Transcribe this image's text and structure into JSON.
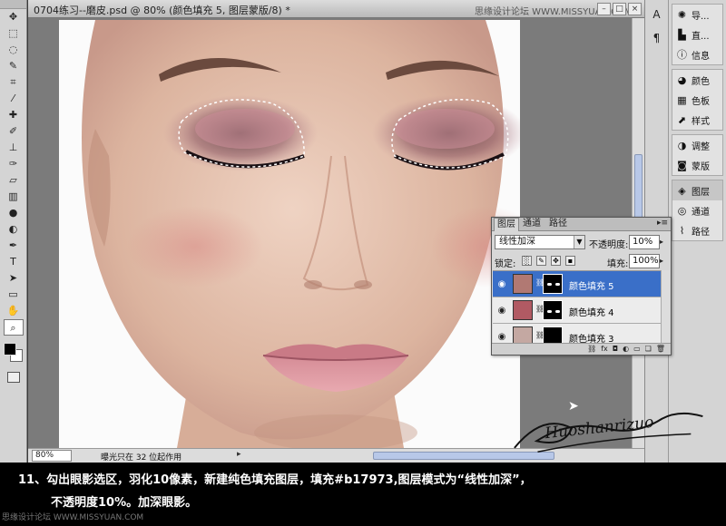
{
  "document": {
    "title": "0704练习--磨皮.psd @ 80% (颜色填充 5, 图层蒙版/8) *",
    "watermark_top": "思缘设计论坛 WWW.MISSYUAN.COM",
    "zoom": "80%",
    "status": "曝光只在 32 位起作用"
  },
  "toolbar": {
    "tools": [
      "move-tool",
      "marquee-tool",
      "lasso-tool",
      "quick-select-tool",
      "crop-tool",
      "eyedropper-tool",
      "healing-tool",
      "brush-tool",
      "clone-stamp-tool",
      "history-brush-tool",
      "eraser-tool",
      "gradient-tool",
      "blur-tool",
      "dodge-tool",
      "pen-tool",
      "type-tool",
      "path-select-tool",
      "shape-tool",
      "hand-tool",
      "zoom-tool"
    ],
    "foreground_color": "#000000",
    "background_color": "#ffffff"
  },
  "dock": {
    "strip_items": [
      "A",
      "¶"
    ],
    "groups": [
      [
        {
          "label": "导...",
          "icon": "navigator-icon"
        },
        {
          "label": "直...",
          "icon": "histogram-icon"
        },
        {
          "label": "信息",
          "icon": "info-icon"
        }
      ],
      [
        {
          "label": "颜色",
          "icon": "color-icon"
        },
        {
          "label": "色板",
          "icon": "swatches-icon"
        },
        {
          "label": "样式",
          "icon": "styles-icon"
        }
      ],
      [
        {
          "label": "调整",
          "icon": "adjustments-icon"
        },
        {
          "label": "蒙版",
          "icon": "masks-icon"
        }
      ],
      [
        {
          "label": "图层",
          "icon": "layers-icon",
          "selected": true
        },
        {
          "label": "通道",
          "icon": "channels-icon"
        },
        {
          "label": "路径",
          "icon": "paths-icon"
        }
      ]
    ]
  },
  "layers_panel": {
    "tabs": [
      "图层",
      "通道",
      "路径"
    ],
    "menu": "▸≡",
    "blend_mode": "线性加深",
    "opacity_label": "不透明度:",
    "opacity": "10%",
    "lock_label": "锁定:",
    "fill_label": "填充:",
    "fill": "100%",
    "layers": [
      {
        "name": "颜色填充 5",
        "fill_color": "#b17973",
        "selected": true
      },
      {
        "name": "颜色填充 4",
        "fill_color": "#b15a63",
        "selected": false
      },
      {
        "name": "颜色填充 3",
        "fill_color": "#c4a8a2",
        "selected": false
      }
    ]
  },
  "signature": "Huoshanrizuo",
  "caption": {
    "line1": "11、勾出眼影选区，羽化10像素，新建纯色填充图层，填充#b17973,图层模式为“线性加深”，",
    "line2": "不透明度10%。加深眼影。",
    "watermark": "思缘设计论坛 WWW.MISSYUAN.COM"
  }
}
